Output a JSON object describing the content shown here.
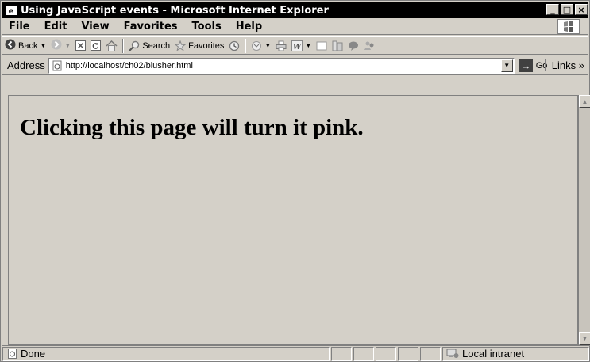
{
  "window": {
    "title": "Using JavaScript events - Microsoft Internet Explorer",
    "buttons": {
      "minimize": "_",
      "maximize": "□",
      "close": "×"
    }
  },
  "menu": [
    "File",
    "Edit",
    "View",
    "Favorites",
    "Tools",
    "Help"
  ],
  "toolbar": {
    "back_label": "Back",
    "search_label": "Search",
    "favorites_label": "Favorites"
  },
  "address": {
    "label": "Address",
    "url": "http://localhost/ch02/blusher.html",
    "go_label": "Go",
    "links_label": "Links »"
  },
  "page": {
    "heading": "Clicking this page will turn it pink."
  },
  "status": {
    "text": "Done",
    "zone": "Local intranet"
  },
  "colors": {
    "titlebar": "#000000",
    "chrome": "#d4d0c8"
  }
}
